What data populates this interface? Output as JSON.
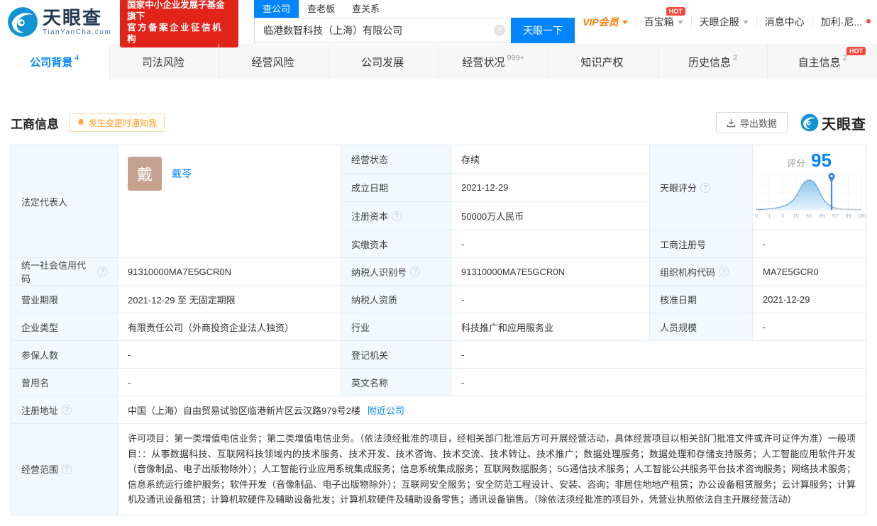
{
  "header": {
    "brand": "天眼查",
    "brand_domain": "TianYanCha.com",
    "badge_line1": "国家中小企业发展子基金旗下",
    "badge_line2": "官方备案企业征信机构",
    "search": {
      "tab_company": "查公司",
      "tab_boss": "查老板",
      "tab_relation": "查关系",
      "value": "临港数智科技（上海）有限公司",
      "button": "天眼一下"
    },
    "menu": {
      "vip": "VIP会员",
      "toolbox": "百宝箱",
      "toolbox_hot": "HOT",
      "service": "天眼企服",
      "messages": "消息中心",
      "user": "加利·尼..."
    }
  },
  "nav": {
    "tabs": [
      {
        "label": "公司背景",
        "count": "4"
      },
      {
        "label": "司法风险",
        "count": ""
      },
      {
        "label": "经营风险",
        "count": ""
      },
      {
        "label": "公司发展",
        "count": ""
      },
      {
        "label": "经营状况",
        "count": "999+"
      },
      {
        "label": "知识产权",
        "count": ""
      },
      {
        "label": "历史信息",
        "count": "2"
      },
      {
        "label": "自主信息",
        "count": "2",
        "hot": "HOT"
      }
    ]
  },
  "section": {
    "title": "工商信息",
    "notify": "发生变更时通知我",
    "export": "导出数据",
    "watermark": "天眼查"
  },
  "score": {
    "label": "天眼评分",
    "prefix": "评分",
    "value": "95",
    "ticks": [
      "0",
      "1",
      "3",
      "15",
      "50",
      "85",
      "97",
      "99",
      "100"
    ]
  },
  "info": {
    "legal_rep_label": "法定代表人",
    "legal_rep_avatar": "戴",
    "legal_rep_name": "戴苓",
    "status_label": "经营状态",
    "status_value": "存续",
    "est_date_label": "成立日期",
    "est_date_value": "2021-12-29",
    "reg_capital_label": "注册资本",
    "reg_capital_value": "50000万人民币",
    "paid_capital_label": "实缴资本",
    "paid_capital_value": "-",
    "reg_no_label": "工商注册号",
    "reg_no_value": "-",
    "credit_code_label": "统一社会信用代码",
    "credit_code_value": "91310000MA7E5GCR0N",
    "taxpayer_id_label": "纳税人识别号",
    "taxpayer_id_value": "91310000MA7E5GCR0N",
    "org_code_label": "组织机构代码",
    "org_code_value": "MA7E5GCR0",
    "term_label": "营业期限",
    "term_value": "2021-12-29 至 无固定期限",
    "taxpayer_qual_label": "纳税人资质",
    "taxpayer_qual_value": "-",
    "approval_date_label": "核准日期",
    "approval_date_value": "2021-12-29",
    "company_type_label": "企业类型",
    "company_type_value": "有限责任公司（外商投资企业法人独资）",
    "industry_label": "行业",
    "industry_value": "科技推广和应用服务业",
    "staff_size_label": "人员规模",
    "staff_size_value": "-",
    "insured_label": "参保人数",
    "insured_value": "-",
    "reg_authority_label": "登记机关",
    "reg_authority_value": "-",
    "former_name_label": "曾用名",
    "former_name_value": "-",
    "english_name_label": "英文名称",
    "english_name_value": "-",
    "address_label": "注册地址",
    "address_value": "中国（上海）自由贸易试验区临港新片区云汉路979号2楼",
    "address_link": "附近公司",
    "scope_label": "经营范围",
    "scope_value": "许可项目：第一类增值电信业务；第二类增值电信业务。（依法须经批准的项目，经相关部门批准后方可开展经营活动，具体经营项目以相关部门批准文件或许可证件为准）一般项目：：从事数据科技、互联网科技领域内的技术服务、技术开发、技术咨询、技术交流、技术转让、技术推广；数据处理服务；数据处理和存储支持服务；人工智能应用软件开发（音像制品、电子出版物除外）；人工智能行业应用系统集成服务；信息系统集成服务；互联网数据服务；5G通信技术服务；人工智能公共服务平台技术咨询服务；网络技术服务；信息系统运行维护服务；软件开发（音像制品、电子出版物除外）；互联网安全服务；安全防范工程设计、安装、咨询；非居住地地产租赁；办公设备租赁服务；云计算服务；计算机及通讯设备租赁；计算机软硬件及辅助设备批发；计算机软硬件及辅助设备零售；通讯设备销售。（除依法须经批准的项目外，凭营业执照依法自主开展经营活动）"
  },
  "colors": {
    "accent_blue": "#0084ff",
    "vip_orange": "#ff7a00",
    "badge_red": "#e2231a",
    "hot_red": "#f5483b",
    "label_bg": "#f2f9fc"
  }
}
